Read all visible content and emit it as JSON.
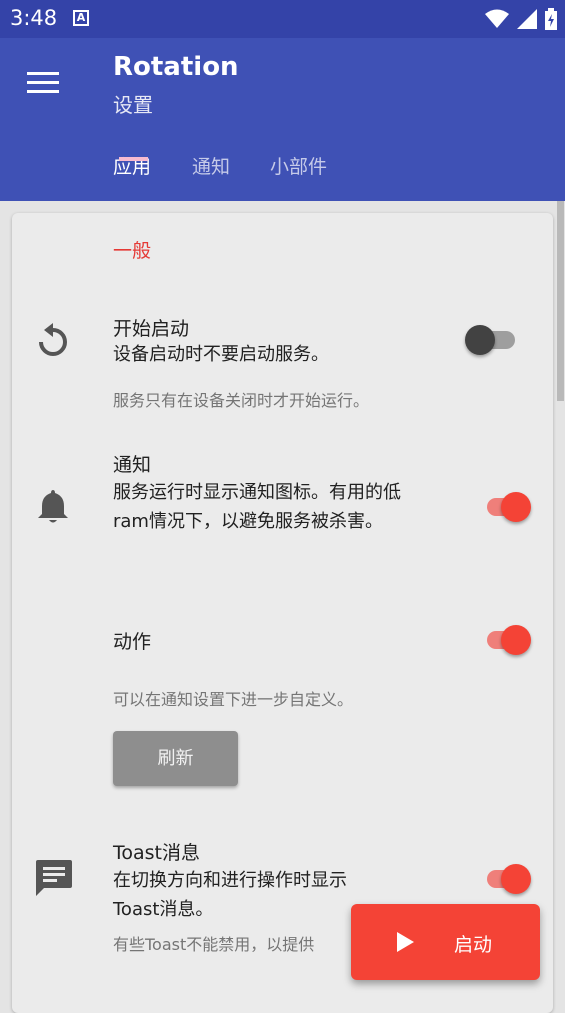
{
  "status": {
    "time": "3:48"
  },
  "appbar": {
    "title": "Rotation",
    "subtitle": "设置"
  },
  "tabs": [
    {
      "label": "应用",
      "active": true
    },
    {
      "label": "通知",
      "active": false
    },
    {
      "label": "小部件",
      "active": false
    }
  ],
  "general": {
    "section_title": "一般",
    "start_on_boot": {
      "title": "开始启动",
      "description": "设备启动时不要启动服务。",
      "hint": "服务只有在设备关闭时才开始运行。",
      "enabled": false
    },
    "notification": {
      "title": "通知",
      "description": "服务运行时显示通知图标。有用的低ram情况下，以避免服务被杀害。",
      "enabled": true
    },
    "actions": {
      "title": "动作",
      "hint": "可以在通知设置下进一步自定义。",
      "enabled": true,
      "refresh_label": "刷新"
    },
    "toast": {
      "title": "Toast消息",
      "description": "在切换方向和进行操作时显示Toast消息。",
      "hint": "有些Toast不能禁用，以提供",
      "enabled": true
    }
  },
  "fab": {
    "label": "启动",
    "icon": "play-icon"
  },
  "colors": {
    "primary": "#3f51b5",
    "primary_dark": "#3443a8",
    "accent": "#f44336"
  }
}
